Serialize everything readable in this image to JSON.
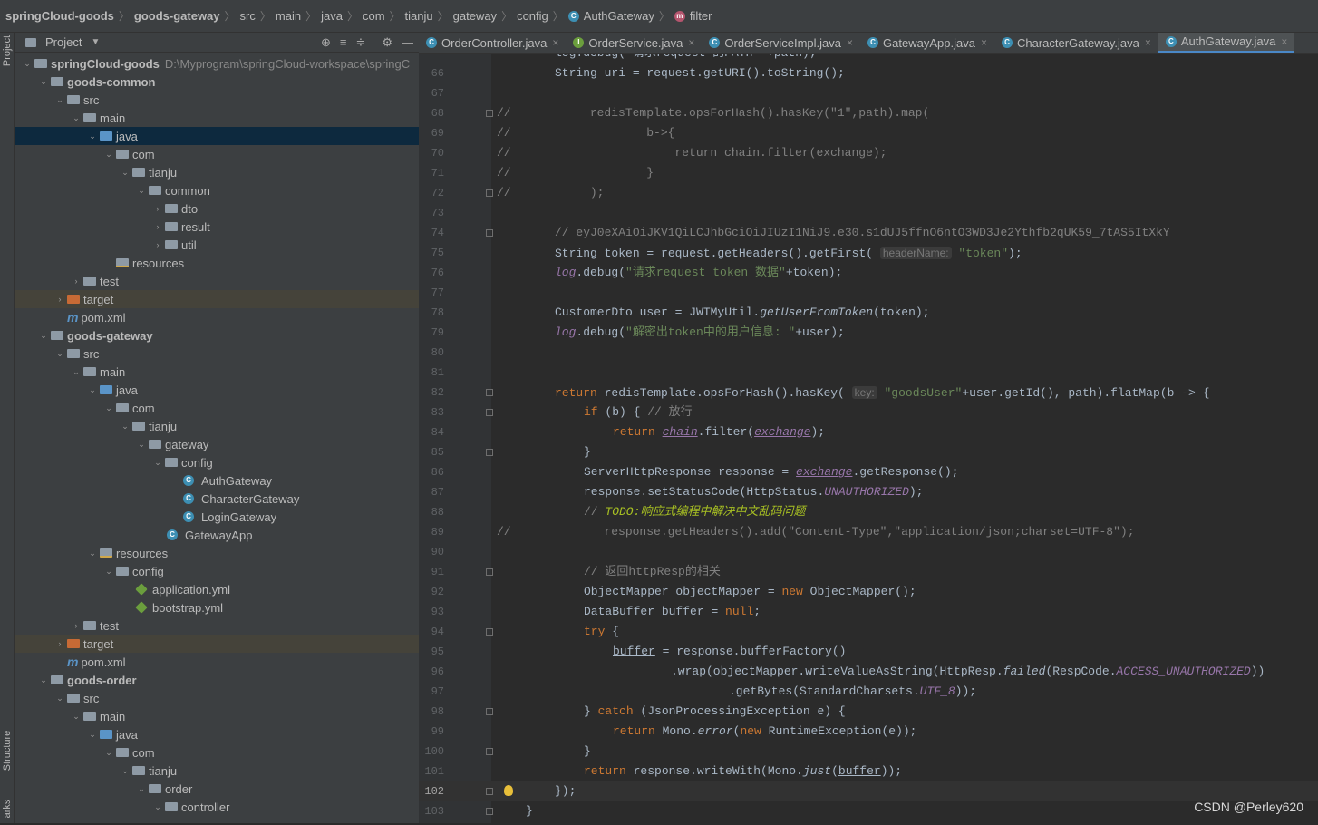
{
  "breadcrumb": [
    "springCloud-goods",
    "goods-gateway",
    "src",
    "main",
    "java",
    "com",
    "tianju",
    "gateway",
    "config",
    "AuthGateway",
    "filter"
  ],
  "sidebar": {
    "vertical_top": "Project",
    "vertical_mid": "Structure",
    "vertical_bottom": "arks"
  },
  "project_panel": {
    "title": "Project",
    "path": "D:\\Myprogram\\springCloud-workspace\\springC"
  },
  "tree": [
    {
      "label": "springCloud-goods",
      "bold": true
    },
    {
      "label": "goods-common",
      "bold": true
    },
    {
      "label": "src"
    },
    {
      "label": "main"
    },
    {
      "label": "java"
    },
    {
      "label": "com"
    },
    {
      "label": "tianju"
    },
    {
      "label": "common"
    },
    {
      "label": "dto"
    },
    {
      "label": "result"
    },
    {
      "label": "util"
    },
    {
      "label": "resources"
    },
    {
      "label": "test"
    },
    {
      "label": "target"
    },
    {
      "label": "pom.xml"
    },
    {
      "label": "goods-gateway",
      "bold": true
    },
    {
      "label": "src"
    },
    {
      "label": "main"
    },
    {
      "label": "java"
    },
    {
      "label": "com"
    },
    {
      "label": "tianju"
    },
    {
      "label": "gateway"
    },
    {
      "label": "config"
    },
    {
      "label": "AuthGateway"
    },
    {
      "label": "CharacterGateway"
    },
    {
      "label": "LoginGateway"
    },
    {
      "label": "GatewayApp"
    },
    {
      "label": "resources"
    },
    {
      "label": "config"
    },
    {
      "label": "application.yml"
    },
    {
      "label": "bootstrap.yml"
    },
    {
      "label": "test"
    },
    {
      "label": "target"
    },
    {
      "label": "pom.xml"
    },
    {
      "label": "goods-order",
      "bold": true
    },
    {
      "label": "src"
    },
    {
      "label": "main"
    },
    {
      "label": "java"
    },
    {
      "label": "com"
    },
    {
      "label": "tianju"
    },
    {
      "label": "order"
    },
    {
      "label": "controller"
    }
  ],
  "tabs": [
    "OrderController.java",
    "OrderService.java",
    "OrderServiceImpl.java",
    "GatewayApp.java",
    "CharacterGateway.java",
    "AuthGateway.java"
  ],
  "line_numbers": [
    "66",
    "67",
    "68",
    "69",
    "70",
    "71",
    "72",
    "73",
    "74",
    "75",
    "76",
    "77",
    "78",
    "79",
    "80",
    "81",
    "82",
    "83",
    "84",
    "85",
    "86",
    "87",
    "88",
    "89",
    "90",
    "91",
    "92",
    "93",
    "94",
    "95",
    "96",
    "97",
    "98",
    "99",
    "100",
    "101",
    "102",
    "103"
  ],
  "code": {
    "l65": "log.debug(\"请求request 的PATH\" +path);",
    "l66a": "String uri = request.getURI().toString();",
    "l68a": "//",
    "l68b": "    redisTemplate.opsForHash().hasKey(\"1\",path).map(",
    "l69a": "//",
    "l69b": "            b->{",
    "l70a": "//",
    "l70b": "                return chain.filter(exchange);",
    "l71a": "//",
    "l71b": "            }",
    "l72a": "//",
    "l72b": "    );",
    "l74": "// eyJ0eXAiOiJKV1QiLCJhbGciOiJIUzI1NiJ9.e30.s1dUJ5ffnO6ntO3WD3Je2Ythfb2qUK59_7tAS5ItXkY",
    "l75a": "String token = request.getHeaders().getFirst(",
    "l75hint": "headerName:",
    "l75s": "\"token\"",
    "l75b": ");",
    "l76a": "log",
    "l76b": ".debug(",
    "l76s": "\"请求request token 数据\"",
    "l76c": "+token);",
    "l78a": "CustomerDto user = JWTMyUtil.",
    "l78f": "getUserFromToken",
    "l78b": "(token);",
    "l79a": "log",
    "l79b": ".debug(",
    "l79s": "\"解密出token中的用户信息: \"",
    "l79c": "+user);",
    "l82k": "return",
    "l82a": " redisTemplate.opsForHash().hasKey(",
    "l82hint": "key:",
    "l82s": "\"goodsUser\"",
    "l82b": "+user.getId(), path).flatMap(b -> {",
    "l83k": "if",
    "l83a": " (b) { ",
    "l83c": "// 放行",
    "l84k": "return",
    "l84u1": "chain",
    "l84a": ".filter(",
    "l84u2": "exchange",
    "l84b": ");",
    "l85": "}",
    "l86a": "ServerHttpResponse response = ",
    "l86u": "exchange",
    "l86b": ".getResponse();",
    "l87a": "response.setStatusCode(HttpStatus.",
    "l87f": "UNAUTHORIZED",
    "l87b": ");",
    "l88c": "// ",
    "l88t": "TODO:响应式编程中解决中文乱码问题",
    "l89a": "//",
    "l89b": "      response.getHeaders().add(\"Content-Type\",\"application/json;charset=UTF-8\");",
    "l91": "// 返回httpResp的相关",
    "l92a": "ObjectMapper objectMapper = ",
    "l92k": "new",
    "l92b": " ObjectMapper();",
    "l93a": "DataBuffer ",
    "l93u": "buffer",
    "l93b": " = ",
    "l93k": "null",
    "l93c": ";",
    "l94k": "try",
    "l94a": " {",
    "l95u": "buffer",
    "l95a": " = response.bufferFactory()",
    "l96a": ".wrap(objectMapper.writeValueAsString(HttpResp.",
    "l96f": "failed",
    "l96b": "(RespCode.",
    "l96f2": "ACCESS_UNAUTHORIZED",
    "l96c": "))",
    "l97a": ".getBytes(StandardCharsets.",
    "l97f": "UTF_8",
    "l97b": "));",
    "l98a": "} ",
    "l98k": "catch",
    "l98b": " (JsonProcessingException e) {",
    "l99k": "return",
    "l99a": " Mono.",
    "l99f": "error",
    "l99b": "(",
    "l99k2": "new",
    "l99c": " RuntimeException(e));",
    "l100": "}",
    "l101k": "return",
    "l101a": " response.writeWith(Mono.",
    "l101f": "just",
    "l101b": "(",
    "l101u": "buffer",
    "l101c": "));",
    "l102": "});",
    "l103": "}"
  },
  "watermark": "CSDN @Perley620",
  "colors": {
    "background": "#2b2b2b",
    "panel": "#3c3f41",
    "keyword": "#cc7832",
    "string": "#6a8759",
    "comment": "#808080",
    "field": "#9876aa",
    "selection": "#0d293e"
  }
}
